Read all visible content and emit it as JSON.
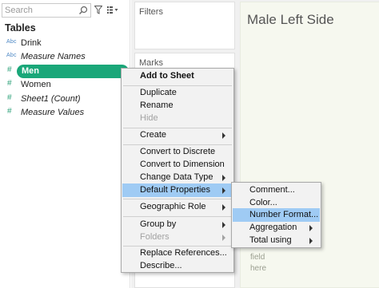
{
  "data_pane": {
    "search_placeholder": "Search",
    "tables_heading": "Tables",
    "fields": [
      {
        "type": "Abc",
        "label": "Drink"
      },
      {
        "type": "Abc",
        "label": "Measure Names"
      },
      {
        "type": "#",
        "label": "Men"
      },
      {
        "type": "#",
        "label": "Women"
      },
      {
        "type": "#",
        "label": "Sheet1 (Count)"
      },
      {
        "type": "#",
        "label": "Measure Values"
      }
    ]
  },
  "shelves": {
    "filters_title": "Filters",
    "marks_title": "Marks"
  },
  "sheet": {
    "title": "Male Left Side",
    "hint_lines": [
      "field",
      "here"
    ]
  },
  "context_menu": {
    "add_to_sheet": "Add to Sheet",
    "duplicate": "Duplicate",
    "rename": "Rename",
    "hide": "Hide",
    "create": "Create",
    "convert_discrete": "Convert to Discrete",
    "convert_dimension": "Convert to Dimension",
    "change_data_type": "Change Data Type",
    "default_properties": "Default Properties",
    "geographic_role": "Geographic Role",
    "group_by": "Group by",
    "folders": "Folders",
    "replace_references": "Replace References...",
    "describe": "Describe..."
  },
  "submenu": {
    "comment": "Comment...",
    "color": "Color...",
    "number_format": "Number Format...",
    "aggregation": "Aggregation",
    "total_using": "Total using"
  },
  "colors": {
    "selected_pill": "#1aa779",
    "menu_highlight": "#9fcbf4",
    "sheet_background": "#f6f8ef"
  }
}
